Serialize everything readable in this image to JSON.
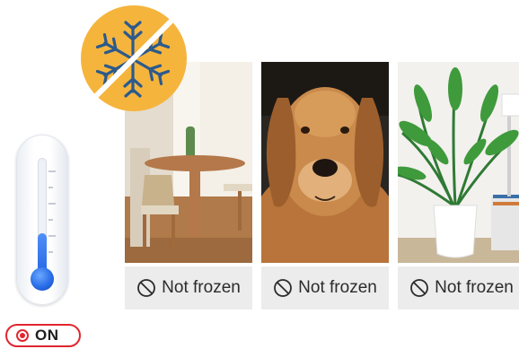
{
  "toggle": {
    "label": "ON",
    "color": "#e0262f"
  },
  "thermometer": {
    "level_percent": 40,
    "fill_color": "#2a6ee8"
  },
  "badge": {
    "icon": "snowflake-icon",
    "color": "#f5b43c"
  },
  "cards": [
    {
      "subject": "dining-room",
      "status": "Not frozen",
      "status_icon": "prohibited-icon"
    },
    {
      "subject": "golden-retriever",
      "status": "Not frozen",
      "status_icon": "prohibited-icon"
    },
    {
      "subject": "potted-palm",
      "status": "Not frozen",
      "status_icon": "prohibited-icon"
    }
  ]
}
